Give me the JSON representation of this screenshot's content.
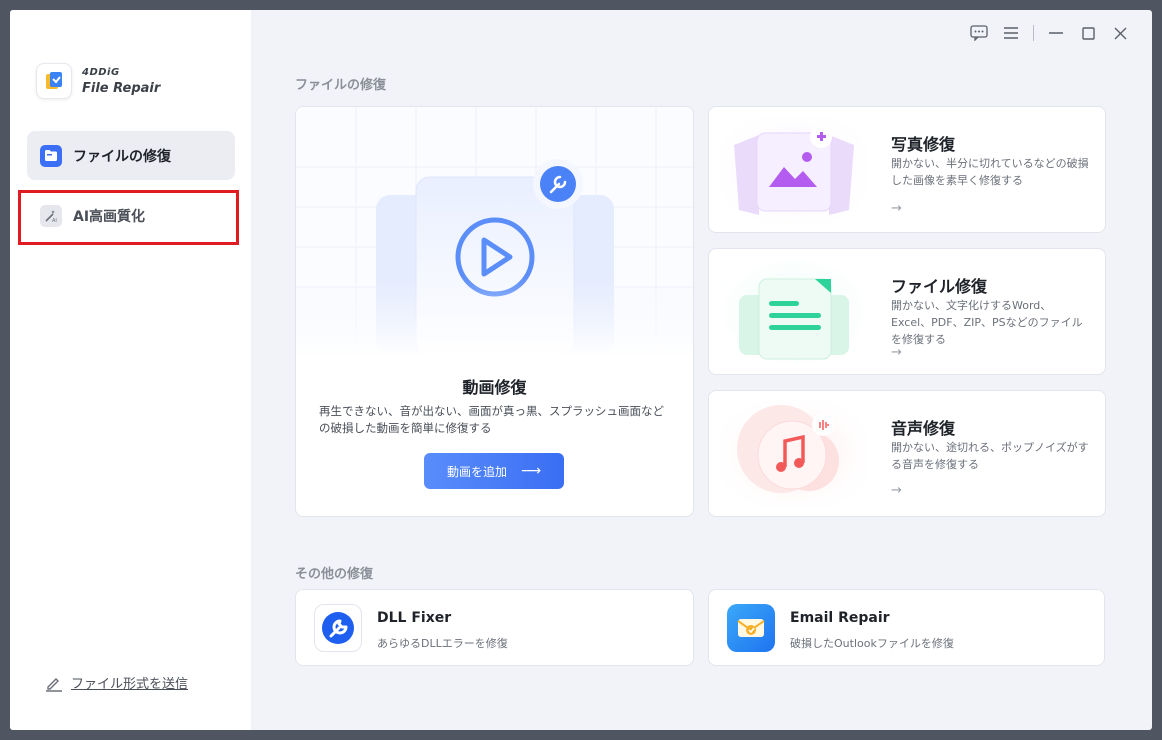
{
  "app": {
    "brand": "4DDiG",
    "product": "File Repair"
  },
  "sidebar": {
    "items": [
      {
        "label": "ファイルの修復",
        "icon": "folder-icon",
        "active": true
      },
      {
        "label": "AI高画質化",
        "icon": "ai-magic-wand-icon",
        "active": false
      }
    ],
    "send_format_label": "ファイル形式を送信"
  },
  "titlebar": {
    "icons": [
      "feedback-icon",
      "menu-icon",
      "minimize-icon",
      "maximize-icon",
      "close-icon"
    ]
  },
  "main": {
    "section_title": "ファイルの修復",
    "video": {
      "title": "動画修復",
      "description": "再生できない、音が出ない、画面が真っ黒、スプラッシュ画面などの破損した動画を簡単に修復する",
      "button_label": "動画を追加",
      "arrow": "⟶"
    },
    "photo": {
      "title": "写真修復",
      "description": "開かない、半分に切れているなどの破損した画像を素早く修復する",
      "arrow": "→"
    },
    "file": {
      "title": "ファイル修復",
      "description": "開かない、文字化けするWord、Excel、PDF、ZIP、PSなどのファイルを修復する",
      "arrow": "→"
    },
    "audio": {
      "title": "音声修復",
      "description": "開かない、途切れる、ポップノイズがする音声を修復する",
      "arrow": "→"
    },
    "other_title": "その他の修復",
    "tools": [
      {
        "title": "DLL Fixer",
        "description": "あらゆるDLLエラーを修復",
        "icon": "dll-wrench-icon"
      },
      {
        "title": "Email Repair",
        "description": "破損したOutlookファイルを修復",
        "icon": "email-envelope-icon"
      }
    ]
  },
  "colors": {
    "accent": "#3b6ff5",
    "highlight_border": "#e01b22",
    "photo": "#b45cf0",
    "file": "#2ed39b",
    "audio": "#f25a5a"
  }
}
